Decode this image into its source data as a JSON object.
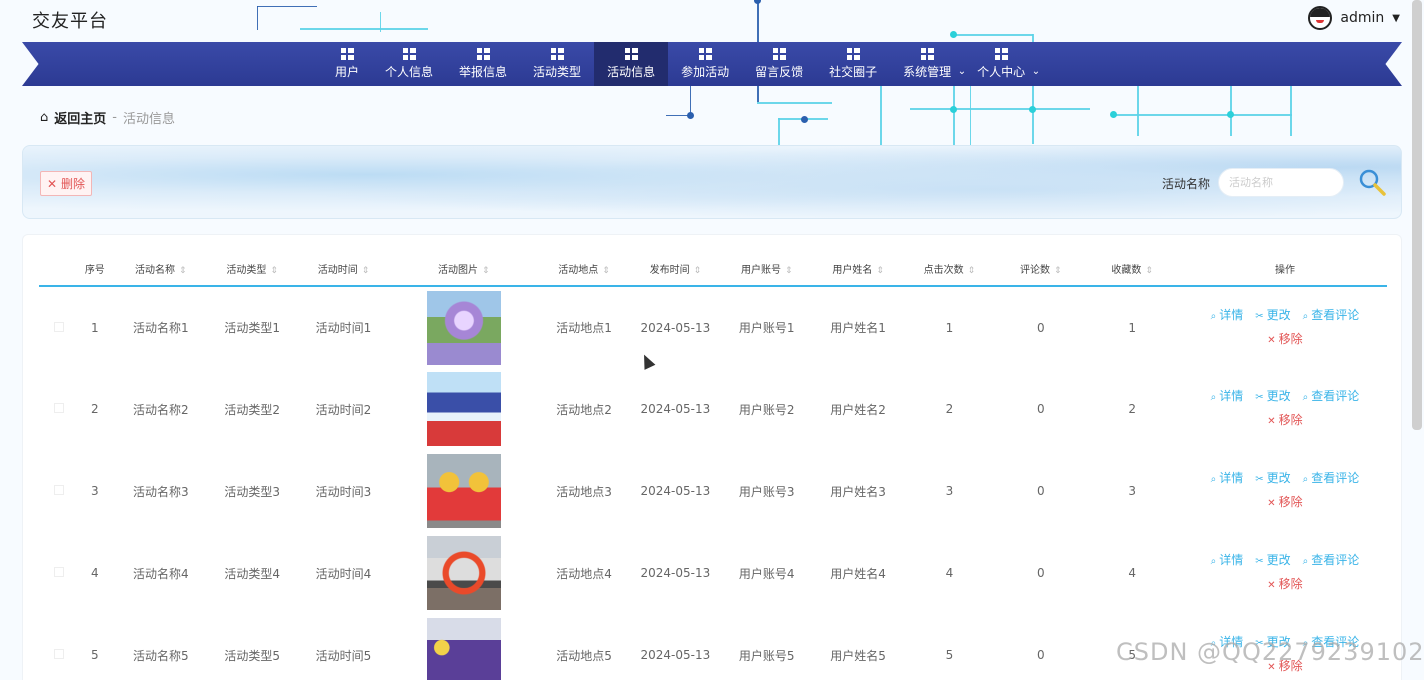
{
  "header": {
    "site_title": "交友平台",
    "username": "admin"
  },
  "nav": {
    "items": [
      {
        "label": "用户",
        "icon": "grid-icon",
        "active": false,
        "dropdown": false
      },
      {
        "label": "个人信息",
        "icon": "grid-icon",
        "active": false,
        "dropdown": false
      },
      {
        "label": "举报信息",
        "icon": "wallet-icon",
        "active": false,
        "dropdown": false
      },
      {
        "label": "活动类型",
        "icon": "pin-icon",
        "active": false,
        "dropdown": false
      },
      {
        "label": "活动信息",
        "icon": "list-icon",
        "active": true,
        "dropdown": false
      },
      {
        "label": "参加活动",
        "icon": "ticket-icon",
        "active": false,
        "dropdown": false
      },
      {
        "label": "留言反馈",
        "icon": "chart-icon",
        "active": false,
        "dropdown": false
      },
      {
        "label": "社交圈子",
        "icon": "list-icon",
        "active": false,
        "dropdown": false
      },
      {
        "label": "系统管理",
        "icon": "grid-icon",
        "active": false,
        "dropdown": true
      },
      {
        "label": "个人中心",
        "icon": "window-icon",
        "active": false,
        "dropdown": true
      }
    ]
  },
  "breadcrumb": {
    "home": "返回主页",
    "separator": "-",
    "current": "活动信息"
  },
  "toolbar": {
    "delete_label": "删除",
    "search_label": "活动名称",
    "search_placeholder": "活动名称"
  },
  "table": {
    "headers": [
      "序号",
      "活动名称",
      "活动类型",
      "活动时间",
      "活动图片",
      "活动地点",
      "发布时间",
      "用户账号",
      "用户姓名",
      "点击次数",
      "评论数",
      "收藏数",
      "操作"
    ],
    "sortable": [
      false,
      true,
      true,
      true,
      true,
      true,
      true,
      true,
      true,
      true,
      true,
      true,
      false
    ],
    "rows": [
      {
        "index": "1",
        "name": "活动名称1",
        "type": "活动类型1",
        "time": "活动时间1",
        "place": "活动地点1",
        "published": "2024-05-13",
        "account": "用户账号1",
        "username": "用户姓名1",
        "clicks": "1",
        "comments": "0",
        "favorites": "1"
      },
      {
        "index": "2",
        "name": "活动名称2",
        "type": "活动类型2",
        "time": "活动时间2",
        "place": "活动地点2",
        "published": "2024-05-13",
        "account": "用户账号2",
        "username": "用户姓名2",
        "clicks": "2",
        "comments": "0",
        "favorites": "2"
      },
      {
        "index": "3",
        "name": "活动名称3",
        "type": "活动类型3",
        "time": "活动时间3",
        "place": "活动地点3",
        "published": "2024-05-13",
        "account": "用户账号3",
        "username": "用户姓名3",
        "clicks": "3",
        "comments": "0",
        "favorites": "3"
      },
      {
        "index": "4",
        "name": "活动名称4",
        "type": "活动类型4",
        "time": "活动时间4",
        "place": "活动地点4",
        "published": "2024-05-13",
        "account": "用户账号4",
        "username": "用户姓名4",
        "clicks": "4",
        "comments": "0",
        "favorites": "4"
      },
      {
        "index": "5",
        "name": "活动名称5",
        "type": "活动类型5",
        "time": "活动时间5",
        "place": "活动地点5",
        "published": "2024-05-13",
        "account": "用户账号5",
        "username": "用户姓名5",
        "clicks": "5",
        "comments": "0",
        "favorites": "5"
      }
    ],
    "actions": {
      "detail": "详情",
      "edit": "更改",
      "view_comments": "查看评论",
      "remove": "移除"
    }
  },
  "watermark": "CSDN @QQ2279239102",
  "colors": {
    "nav_bg": "#2c3a93",
    "nav_active": "#222c6e",
    "accent": "#3ab4e8",
    "danger": "#e25555"
  }
}
